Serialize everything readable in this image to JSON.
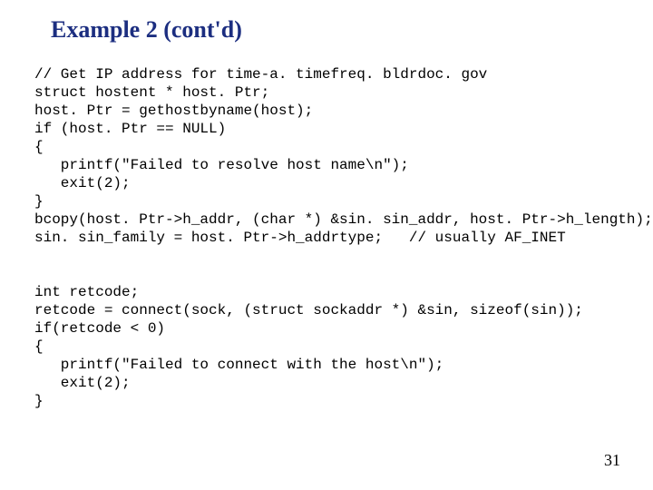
{
  "title": "Example 2 (cont'd)",
  "code_lines": [
    "// Get IP address for time-a. timefreq. bldrdoc. gov",
    "struct hostent * host. Ptr;",
    "host. Ptr = gethostbyname(host);",
    "if (host. Ptr == NULL)",
    "{",
    "   printf(\"Failed to resolve host name\\n\");",
    "   exit(2);",
    "}",
    "bcopy(host. Ptr->h_addr, (char *) &sin. sin_addr, host. Ptr->h_length);",
    "sin. sin_family = host. Ptr->h_addrtype;   // usually AF_INET",
    "",
    "",
    "int retcode;",
    "retcode = connect(sock, (struct sockaddr *) &sin, sizeof(sin));",
    "if(retcode < 0)",
    "{",
    "   printf(\"Failed to connect with the host\\n\");",
    "   exit(2);",
    "}"
  ],
  "page_number": "31"
}
